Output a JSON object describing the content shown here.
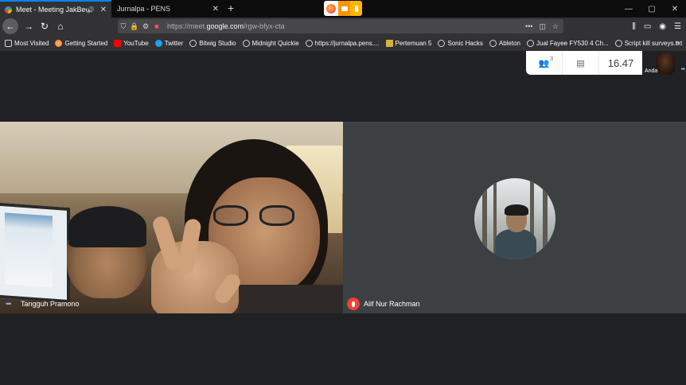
{
  "browser": {
    "tabs": [
      {
        "title": "Meet - Meeting JakBee",
        "active": true,
        "audio": true
      },
      {
        "title": "Jurnalpa - PENS",
        "active": false
      }
    ],
    "new_tab_label": "+",
    "url": {
      "prefix": "https://meet.",
      "domain": "google.com",
      "path": "/rgw-bfyx-cta"
    },
    "window_controls": {
      "minimize": "—",
      "maximize": "▢",
      "close": "✕"
    },
    "bookmarks": [
      {
        "label": "Most Visited",
        "icon": "gear-icon"
      },
      {
        "label": "Getting Started",
        "icon": "firefox-icon"
      },
      {
        "label": "YouTube",
        "icon": "youtube-icon"
      },
      {
        "label": "Twitter",
        "icon": "twitter-icon"
      },
      {
        "label": "Bitwig Studio",
        "icon": "globe-icon"
      },
      {
        "label": "Midnight Quickie",
        "icon": "globe-icon"
      },
      {
        "label": "https://jurnalpa.pens....",
        "icon": "globe-icon"
      },
      {
        "label": "Pertemuan 5",
        "icon": "bookmark-image-icon"
      },
      {
        "label": "Sonic Hacks",
        "icon": "globe-icon"
      },
      {
        "label": "Ableton",
        "icon": "globe-icon"
      },
      {
        "label": "Jual Fayee FY530 4 Ch...",
        "icon": "globe-icon"
      },
      {
        "label": "Script kill surveys.txt",
        "icon": "globe-icon"
      }
    ]
  },
  "meet": {
    "participants_count": "3",
    "clock": "16.47",
    "self_label": "Anda",
    "tiles": [
      {
        "name": "Tangguh Pramono",
        "muted": false
      },
      {
        "name": "Alif Nur Rachman",
        "muted": true
      }
    ],
    "accent": "#8ab4f8",
    "mute_color": "#ea4335"
  }
}
